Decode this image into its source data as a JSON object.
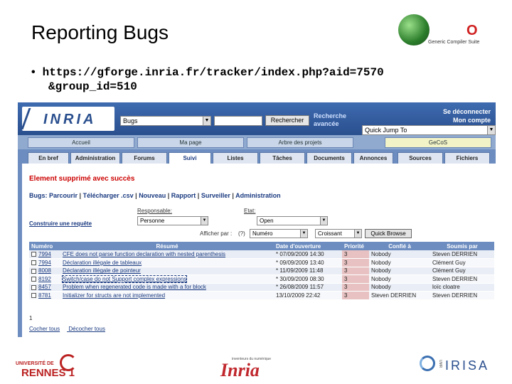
{
  "slide": {
    "title": "Reporting Bugs",
    "bullet_line1": "https://gforge.inria.fr/tracker/index.php?aid=7570",
    "bullet_line2": "&group_id=510",
    "bullet_symbol": "•",
    "gcs_logo_letter": "O",
    "gcs_logo_text": "Generic Compiler Suite"
  },
  "topbar": {
    "logo_text": "INRIA",
    "search_scope": "Bugs",
    "search_value": "",
    "search_button": "Rechercher",
    "advanced_line1": "Recherche",
    "advanced_line2": "avancée",
    "logout": "Se déconnecter",
    "my_account": "Mon compte",
    "quick_jump": "Quick Jump To"
  },
  "nav": {
    "tabs": [
      "Accueil",
      "Ma page",
      "Arbre des projets",
      "GeCoS"
    ]
  },
  "subtabs": [
    "En bref",
    "Administration",
    "Forums",
    "Suivi",
    "Listes",
    "Tâches",
    "Documents",
    "Annonces",
    "Sources",
    "Fichiers"
  ],
  "content": {
    "deleted_msg": "Element supprimé avec succès",
    "menu": {
      "prefix": "Bugs: Parcourir",
      "items": [
        "Télécharger .csv",
        "Nouveau",
        "Rapport",
        "Surveiller",
        "Administration"
      ],
      "sep": "|"
    },
    "build_query": "Construire une requête",
    "assignee_label": "Responsable:",
    "assignee_value": "Personne",
    "state_label": "Etat:",
    "state_value": "Open",
    "sort_label": "Afficher par :",
    "sort_help": "(?)",
    "sort_field": "Numéro",
    "sort_order": "Croissant",
    "browse_button": "Quick Browse",
    "columns": [
      "Numéro",
      "Résumé",
      "Date d'ouverture",
      "Priorité",
      "Confié à",
      "Soumis par"
    ],
    "rows": [
      {
        "id": "7994",
        "summary": "CFE does not parse function declaration with nested parenthesis",
        "date": "* 07/09/2009 14:30",
        "priority": "3",
        "assigned": "Nobody",
        "submitter": "Steven DERRIEN"
      },
      {
        "id": "7994",
        "summary": "Déclaration illégale de tableaux",
        "date": "* 09/09/2009 13:40",
        "priority": "3",
        "assigned": "Nobody",
        "submitter": "Clément Guy"
      },
      {
        "id": "8008",
        "summary": "Déclaration illégale de pointeur",
        "date": "* 11/09/2009 11:48",
        "priority": "3",
        "assigned": "Nobody",
        "submitter": "Clément Guy"
      },
      {
        "id": "8192",
        "summary": "Switch/case do not Support complex expressions",
        "date": "* 30/09/2009 08:30",
        "priority": "3",
        "assigned": "Nobody",
        "submitter": "Steven DERRIEN"
      },
      {
        "id": "8457",
        "summary": "Problem when regenerated code is made with a for block",
        "date": "* 26/08/2009 11:57",
        "priority": "3",
        "assigned": "Nobody",
        "submitter": "loïc cloatre"
      },
      {
        "id": "8781",
        "summary": "Initializer for structs are not implemented",
        "date": "13/10/2009 22:42",
        "priority": "3",
        "assigned": "Steven DERRIEN",
        "submitter": "Steven DERRIEN"
      }
    ],
    "page_number": "1",
    "check_all": "Cocher tous",
    "uncheck_all": "Décocher tous"
  },
  "footer": {
    "rennes_small": "UNIVERSITÉ DE",
    "rennes_big": "RENNES 1",
    "inria_text": "Inria",
    "inria_sub": "inventeurs du numérique",
    "irisa_text": "IRISA",
    "irisa_vertical": "UMR"
  },
  "colors": {
    "header_blue": "#2a4f8e",
    "tab_blue": "#6d8dc0",
    "priority_bg": "#e8c2c2",
    "alert_red": "#cc0000"
  }
}
